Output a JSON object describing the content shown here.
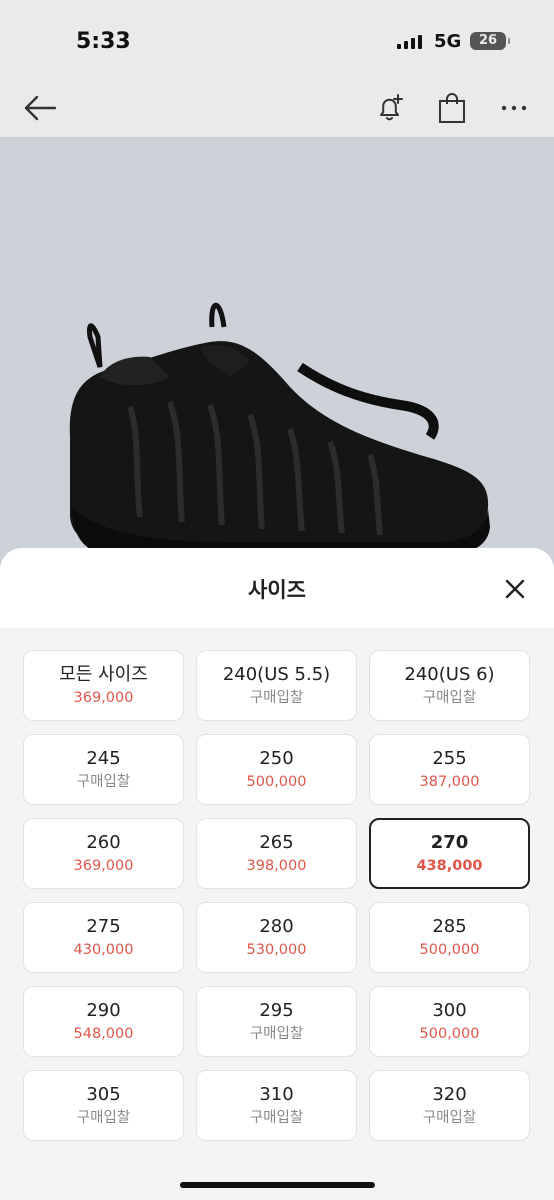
{
  "status": {
    "time": "5:33",
    "network": "5G",
    "battery": "26"
  },
  "nav": {
    "back_icon": "arrow-left-icon",
    "alert_icon": "bell-plus-icon",
    "bag_icon": "shopping-bag-icon",
    "more_icon": "more-dots-icon"
  },
  "sheet": {
    "title": "사이즈",
    "close_icon": "close-icon",
    "selected_index": 8,
    "sizes": [
      {
        "size": "모든 사이즈",
        "price": "369,000",
        "kind": "price"
      },
      {
        "size": "240(US 5.5)",
        "price": "구매입찰",
        "kind": "bid"
      },
      {
        "size": "240(US 6)",
        "price": "구매입찰",
        "kind": "bid"
      },
      {
        "size": "245",
        "price": "구매입찰",
        "kind": "bid"
      },
      {
        "size": "250",
        "price": "500,000",
        "kind": "price"
      },
      {
        "size": "255",
        "price": "387,000",
        "kind": "price"
      },
      {
        "size": "260",
        "price": "369,000",
        "kind": "price"
      },
      {
        "size": "265",
        "price": "398,000",
        "kind": "price"
      },
      {
        "size": "270",
        "price": "438,000",
        "kind": "price"
      },
      {
        "size": "275",
        "price": "430,000",
        "kind": "price"
      },
      {
        "size": "280",
        "price": "530,000",
        "kind": "price"
      },
      {
        "size": "285",
        "price": "500,000",
        "kind": "price"
      },
      {
        "size": "290",
        "price": "548,000",
        "kind": "price"
      },
      {
        "size": "295",
        "price": "구매입찰",
        "kind": "bid"
      },
      {
        "size": "300",
        "price": "500,000",
        "kind": "price"
      },
      {
        "size": "305",
        "price": "구매입찰",
        "kind": "bid"
      },
      {
        "size": "310",
        "price": "구매입찰",
        "kind": "bid"
      },
      {
        "size": "320",
        "price": "구매입찰",
        "kind": "bid"
      }
    ]
  },
  "colors": {
    "price": "#e0564a",
    "bid": "#8a8a8a",
    "selected_border": "#222222",
    "hero_bg": "#cdd2d9"
  }
}
